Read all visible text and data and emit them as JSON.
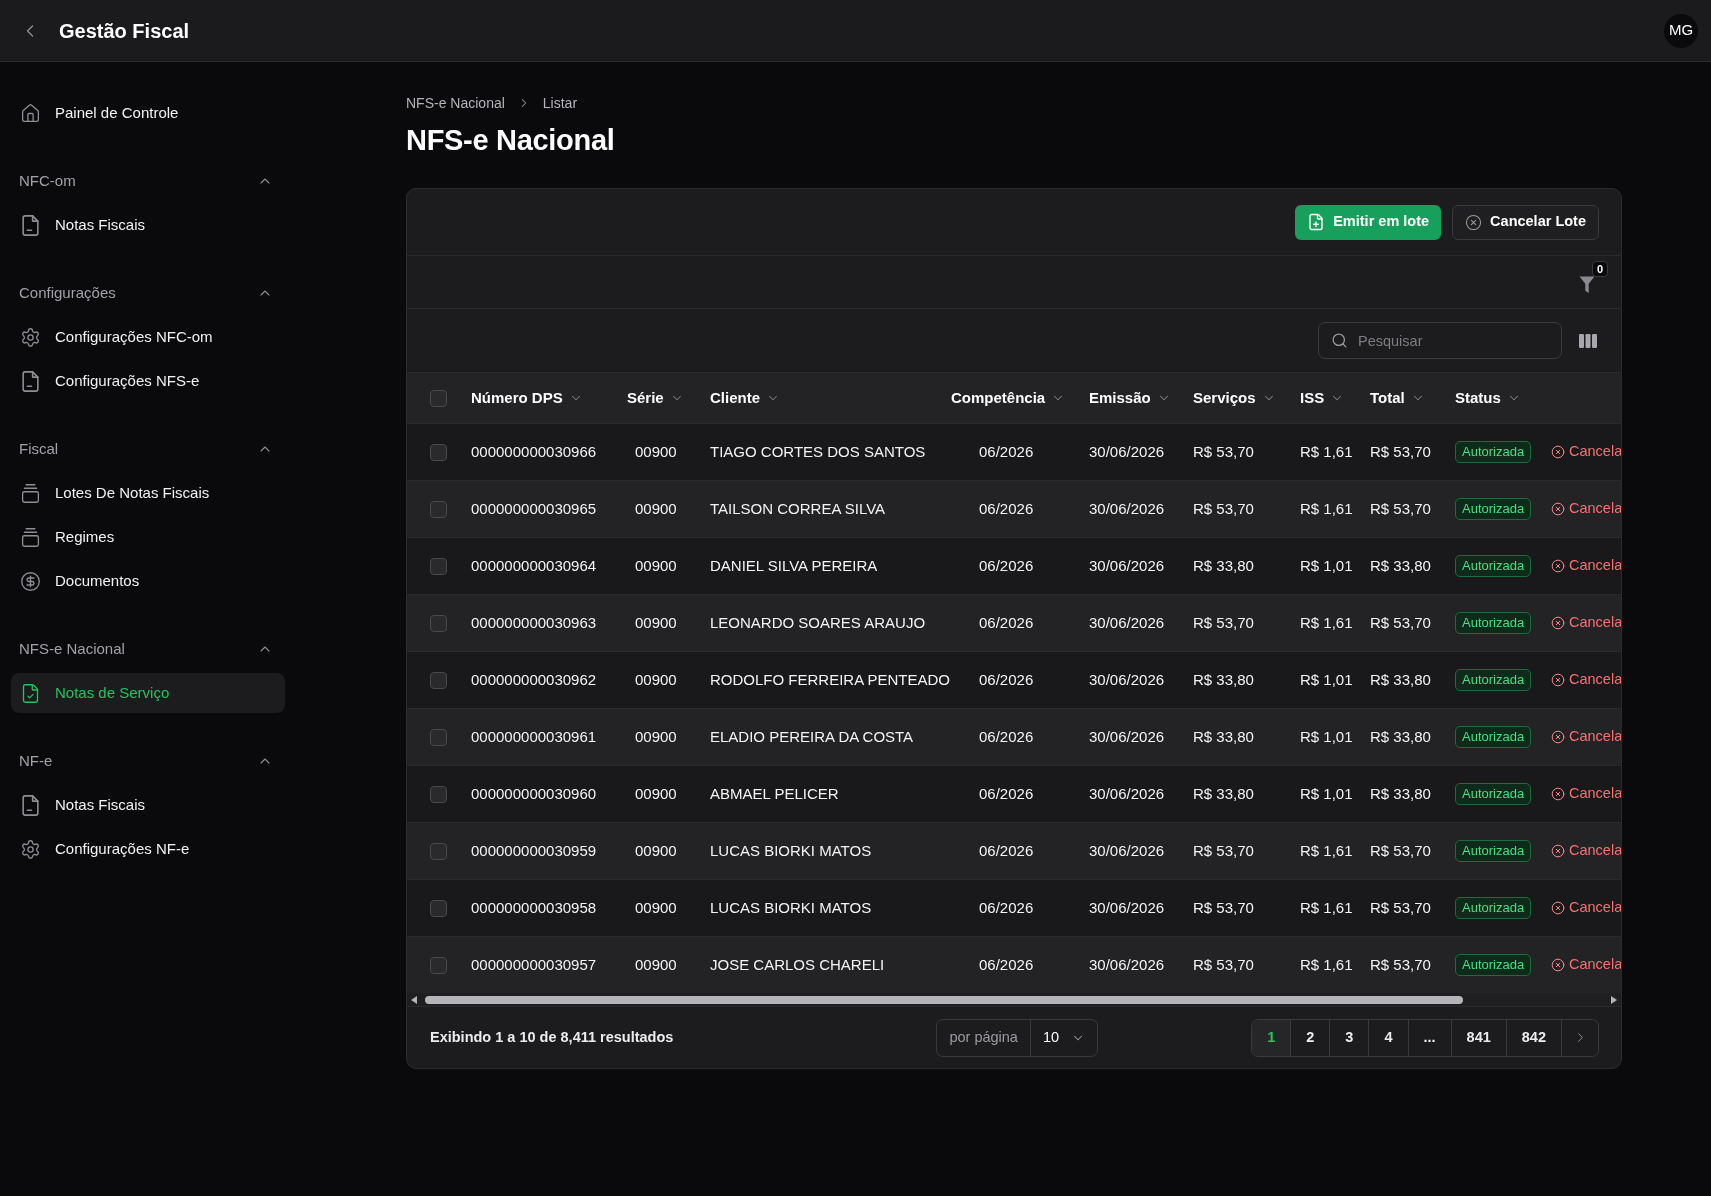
{
  "top_bar": {
    "title": "Gestão Fiscal",
    "avatar": "MG"
  },
  "sidebar": {
    "items": [
      {
        "label": "Painel de Controle",
        "selected": false
      }
    ],
    "sections": [
      {
        "title": "NFC-om",
        "expanded": true,
        "items": [
          {
            "label": "Notas Fiscais",
            "selected": false
          }
        ]
      },
      {
        "title": "Configurações",
        "expanded": true,
        "items": [
          {
            "label": "Configurações NFC-om",
            "selected": false
          },
          {
            "label": "Configurações NFS-e",
            "selected": false
          }
        ]
      },
      {
        "title": "Fiscal",
        "expanded": true,
        "items": [
          {
            "label": "Lotes De Notas Fiscais",
            "selected": false
          },
          {
            "label": "Regimes",
            "selected": false
          },
          {
            "label": "Documentos",
            "selected": false
          }
        ]
      },
      {
        "title": "NFS-e Nacional",
        "expanded": true,
        "items": [
          {
            "label": "Notas de Serviço",
            "selected": true
          }
        ]
      },
      {
        "title": "NF-e",
        "expanded": true,
        "items": [
          {
            "label": "Notas Fiscais",
            "selected": false
          },
          {
            "label": "Configurações NF-e",
            "selected": false
          }
        ]
      }
    ]
  },
  "breadcrumb": [
    "NFS-e Nacional",
    "Listar"
  ],
  "page_title": "NFS-e Nacional",
  "toolbar": {
    "buttons": [
      {
        "label": "Emitir em lote",
        "kind": "primary"
      },
      {
        "label": "Cancelar Lote",
        "kind": "secondary"
      }
    ],
    "filter_count": "0",
    "search": {
      "placeholder": "Pesquisar"
    }
  },
  "table": {
    "select_all": {
      "checked": false
    },
    "columns": [
      "Número DPS",
      "Série",
      "Cliente",
      "Competência",
      "Emissão",
      "Serviços",
      "ISS",
      "Total",
      "Status"
    ],
    "rows": [
      {
        "checked": false,
        "cells": [
          "000000000030966",
          "00900",
          "TIAGO CORTES DOS SANTOS",
          "06/2026",
          "30/06/2026",
          "R$ 53,70",
          "R$ 1,61",
          "R$ 53,70"
        ],
        "status": "Autorizada",
        "action": "Cancela"
      },
      {
        "checked": false,
        "cells": [
          "000000000030965",
          "00900",
          "TAILSON CORREA SILVA",
          "06/2026",
          "30/06/2026",
          "R$ 53,70",
          "R$ 1,61",
          "R$ 53,70"
        ],
        "status": "Autorizada",
        "action": "Cancela"
      },
      {
        "checked": false,
        "cells": [
          "000000000030964",
          "00900",
          "DANIEL SILVA PEREIRA",
          "06/2026",
          "30/06/2026",
          "R$ 33,80",
          "R$ 1,01",
          "R$ 33,80"
        ],
        "status": "Autorizada",
        "action": "Cancela"
      },
      {
        "checked": false,
        "cells": [
          "000000000030963",
          "00900",
          "LEONARDO SOARES ARAUJO",
          "06/2026",
          "30/06/2026",
          "R$ 53,70",
          "R$ 1,61",
          "R$ 53,70"
        ],
        "status": "Autorizada",
        "action": "Cancela"
      },
      {
        "checked": false,
        "cells": [
          "000000000030962",
          "00900",
          "RODOLFO FERREIRA PENTEADO",
          "06/2026",
          "30/06/2026",
          "R$ 33,80",
          "R$ 1,01",
          "R$ 33,80"
        ],
        "status": "Autorizada",
        "action": "Cancela"
      },
      {
        "checked": false,
        "cells": [
          "000000000030961",
          "00900",
          "ELADIO PEREIRA DA COSTA",
          "06/2026",
          "30/06/2026",
          "R$ 33,80",
          "R$ 1,01",
          "R$ 33,80"
        ],
        "status": "Autorizada",
        "action": "Cancela"
      },
      {
        "checked": false,
        "cells": [
          "000000000030960",
          "00900",
          "ABMAEL PELICER",
          "06/2026",
          "30/06/2026",
          "R$ 33,80",
          "R$ 1,01",
          "R$ 33,80"
        ],
        "status": "Autorizada",
        "action": "Cancela"
      },
      {
        "checked": false,
        "cells": [
          "000000000030959",
          "00900",
          "LUCAS BIORKI MATOS",
          "06/2026",
          "30/06/2026",
          "R$ 53,70",
          "R$ 1,61",
          "R$ 53,70"
        ],
        "status": "Autorizada",
        "action": "Cancela"
      },
      {
        "checked": false,
        "cells": [
          "000000000030958",
          "00900",
          "LUCAS BIORKI MATOS",
          "06/2026",
          "30/06/2026",
          "R$ 53,70",
          "R$ 1,61",
          "R$ 53,70"
        ],
        "status": "Autorizada",
        "action": "Cancela"
      },
      {
        "checked": false,
        "cells": [
          "000000000030957",
          "00900",
          "JOSE CARLOS CHARELI",
          "06/2026",
          "30/06/2026",
          "R$ 53,70",
          "R$ 1,61",
          "R$ 53,70"
        ],
        "status": "Autorizada",
        "action": "Cancela"
      }
    ]
  },
  "footer": {
    "summary": "Exibindo 1 a 10 de 8,411 resultados",
    "per_page": {
      "label": "por página",
      "value": "10"
    },
    "pages": [
      {
        "label": "1",
        "selected": true
      },
      {
        "label": "2",
        "selected": false
      },
      {
        "label": "3",
        "selected": false
      },
      {
        "label": "4",
        "selected": false
      },
      {
        "label": "...",
        "selected": false
      },
      {
        "label": "841",
        "selected": false
      },
      {
        "label": "842",
        "selected": false
      }
    ]
  }
}
